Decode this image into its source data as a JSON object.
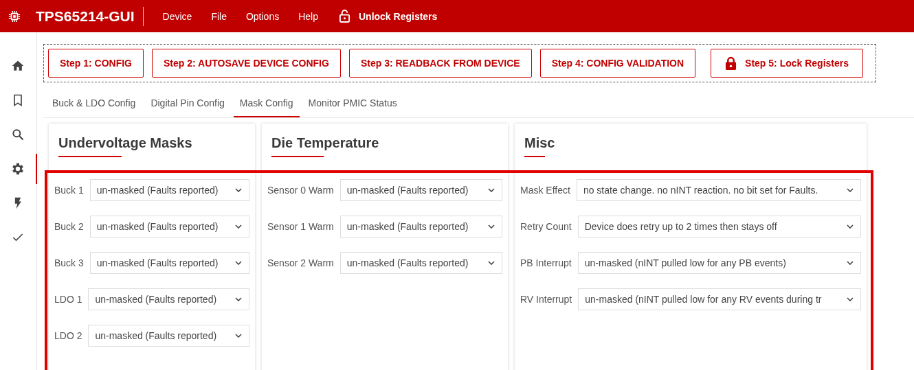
{
  "app": {
    "title": "TPS65214-GUI"
  },
  "menu": [
    {
      "label": "Device"
    },
    {
      "label": "File"
    },
    {
      "label": "Options"
    },
    {
      "label": "Help"
    }
  ],
  "unlock_button": {
    "label": "Unlock Registers"
  },
  "sidebar": {
    "items": [
      {
        "kind": "home",
        "selected": false
      },
      {
        "kind": "bookmark",
        "selected": false
      },
      {
        "kind": "search",
        "selected": false
      },
      {
        "kind": "settings",
        "selected": true
      },
      {
        "kind": "bolt",
        "selected": false
      },
      {
        "kind": "check",
        "selected": false
      }
    ]
  },
  "steps": [
    {
      "label": "Step 1: CONFIG",
      "kind": "plain"
    },
    {
      "label": "Step 2: AUTOSAVE DEVICE CONFIG",
      "kind": "plain"
    },
    {
      "label": "Step 3: READBACK FROM DEVICE",
      "kind": "plain"
    },
    {
      "label": "Step 4: CONFIG VALIDATION",
      "kind": "plain"
    },
    {
      "label": "Step 5: Lock Registers",
      "kind": "lock"
    }
  ],
  "tabs": [
    {
      "label": "Buck & LDO Config",
      "selected": false
    },
    {
      "label": "Digital Pin Config",
      "selected": false
    },
    {
      "label": "Mask Config",
      "selected": true
    },
    {
      "label": "Monitor PMIC Status",
      "selected": false
    }
  ],
  "cards": [
    {
      "title": "Undervoltage Masks",
      "fields": [
        {
          "label": "Buck 1",
          "value": "un-masked (Faults reported)"
        },
        {
          "label": "Buck 2",
          "value": "un-masked (Faults reported)"
        },
        {
          "label": "Buck 3",
          "value": "un-masked (Faults reported)"
        },
        {
          "label": "LDO 1",
          "value": "un-masked (Faults reported)"
        },
        {
          "label": "LDO 2",
          "value": "un-masked (Faults reported)"
        }
      ]
    },
    {
      "title": "Die Temperature",
      "fields": [
        {
          "label": "Sensor 0 Warm",
          "value": "un-masked (Faults reported)"
        },
        {
          "label": "Sensor 1 Warm",
          "value": "un-masked (Faults reported)"
        },
        {
          "label": "Sensor 2 Warm",
          "value": "un-masked (Faults reported)"
        }
      ]
    },
    {
      "title": "Misc",
      "fields": [
        {
          "label": "Mask Effect",
          "value": "no state change. no nINT reaction. no bit set for Faults."
        },
        {
          "label": "Retry Count",
          "value": "Device does retry up to 2 times then stays off"
        },
        {
          "label": "PB Interrupt",
          "value": "un-masked (nINT pulled low for any PB events)"
        },
        {
          "label": "RV Interrupt",
          "value": "un-masked (nINT pulled low for any RV events during tr"
        }
      ]
    }
  ]
}
